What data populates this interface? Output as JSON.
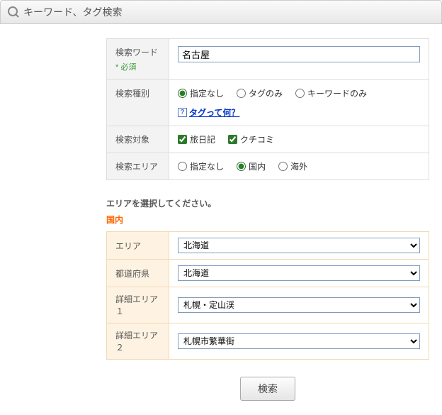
{
  "header": {
    "title": "キーワード、タグ検索"
  },
  "form": {
    "keyword": {
      "label": "検索ワード",
      "required": "* 必須",
      "value": "名古屋"
    },
    "type": {
      "label": "検索種別",
      "options": [
        {
          "label": "指定なし",
          "checked": true
        },
        {
          "label": "タグのみ",
          "checked": false
        },
        {
          "label": "キーワードのみ",
          "checked": false
        }
      ],
      "help_icon": "?",
      "help_link": "タグって何？"
    },
    "target": {
      "label": "検索対象",
      "options": [
        {
          "label": "旅日記",
          "checked": true
        },
        {
          "label": "クチコミ",
          "checked": true
        }
      ]
    },
    "area_scope": {
      "label": "検索エリア",
      "options": [
        {
          "label": "指定なし",
          "checked": false
        },
        {
          "label": "国内",
          "checked": true
        },
        {
          "label": "海外",
          "checked": false
        }
      ]
    }
  },
  "area_section": {
    "instruction": "エリアを選択してください。",
    "heading": "国内",
    "rows": [
      {
        "label": "エリア",
        "value": "北海道"
      },
      {
        "label": "都道府県",
        "value": "北海道"
      },
      {
        "label": "詳細エリア１",
        "value": "札幌・定山渓"
      },
      {
        "label": "詳細エリア２",
        "value": "札幌市繁華街"
      }
    ]
  },
  "submit": {
    "label": "検索"
  }
}
